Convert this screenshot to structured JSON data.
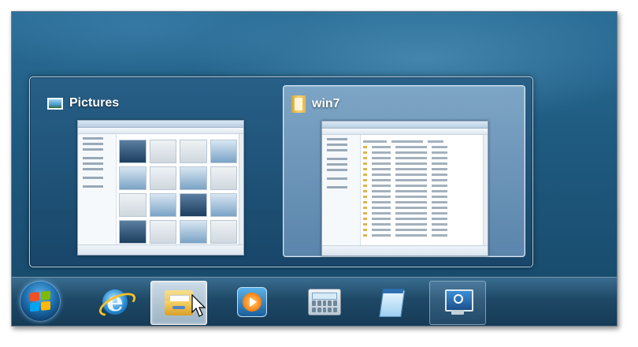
{
  "thumbnail_flyout": {
    "cards": [
      {
        "title": "Pictures",
        "icon": "pictures-library-icon",
        "selected": false
      },
      {
        "title": "win7",
        "icon": "folder-icon",
        "selected": true
      }
    ]
  },
  "taskbar": {
    "start_button": {
      "icon": "windows-orb-icon"
    },
    "items": [
      {
        "name": "internet-explorer",
        "icon": "internet-explorer-icon",
        "state": "pinned"
      },
      {
        "name": "windows-explorer",
        "icon": "windows-explorer-icon",
        "state": "active"
      },
      {
        "name": "windows-media-player",
        "icon": "media-player-icon",
        "state": "pinned"
      },
      {
        "name": "calculator",
        "icon": "calculator-icon",
        "state": "pinned"
      },
      {
        "name": "notepad",
        "icon": "notepad-icon",
        "state": "pinned"
      },
      {
        "name": "remote-desktop",
        "icon": "remote-desktop-icon",
        "state": "running"
      }
    ]
  },
  "colors": {
    "desktop": "#1f5a80",
    "taskbar": "#1e4866",
    "selected_card": "#8fb2d2",
    "start_orb": "#1e6fb0"
  }
}
